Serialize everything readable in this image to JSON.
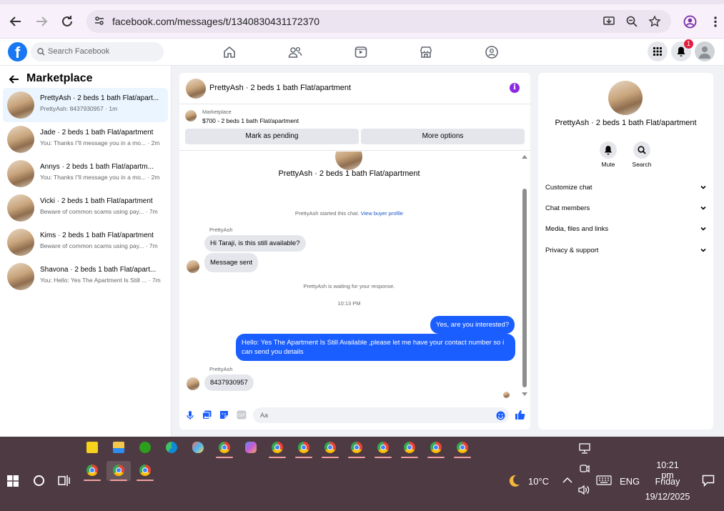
{
  "browser": {
    "url": "facebook.com/messages/t/1340830431172370"
  },
  "facebook": {
    "logo": "f",
    "search_placeholder": "Search Facebook",
    "notification_count": "1"
  },
  "left": {
    "title": "Marketplace",
    "conversations": [
      {
        "title": "PrettyAsh · 2 beds 1 bath Flat/apart...",
        "preview": "PrettyAsh: 8437930957 · 1m"
      },
      {
        "title": "Jade · 2 beds 1 bath Flat/apartment",
        "preview": "You: Thanks i\"ll message you in a mo... · 2m"
      },
      {
        "title": "Annys · 2 beds 1 bath Flat/apartm...",
        "preview": "You: Thanks i\"ll message you in a mo... · 2m"
      },
      {
        "title": "Vicki · 2 beds 1 bath Flat/apartment",
        "preview": "Beware of common scams using pay... · 7m"
      },
      {
        "title": "Kims · 2 beds 1 bath Flat/apartment",
        "preview": "Beware of common scams using pay... · 7m"
      },
      {
        "title": "Shavona · 2 beds 1 bath Flat/apart...",
        "preview": "You: Hello: Yes The Apartment Is Still ... · 7m"
      }
    ]
  },
  "chat": {
    "header_name": "PrettyAsh · 2 beds 1 bath Flat/apartment",
    "info_glyph": "i",
    "marketplace_label": "Marketplace",
    "listing": "$700 - 2 beds 1 bath Flat/apartment",
    "mark_pending": "Mark as pending",
    "more_options": "More options",
    "profile_name": "PrettyAsh · 2 beds 1 bath Flat/apartment",
    "started_text": "PrettyAsh started this chat.",
    "view_profile": "View buyer profile",
    "sender1": "PrettyAsh",
    "msg1": "Hi Taraji, is this still available?",
    "msg2": "Message sent",
    "waiting": "PrettyAsh is waiting for your response.",
    "time": "10:13 PM",
    "out1": "Yes, are you interested?",
    "out2": "Hello: Yes The Apartment Is Still Available ,please let me have your contact number so i can send you details",
    "sender2": "PrettyAsh",
    "msg3": "8437930957",
    "composer_placeholder": "Aa"
  },
  "right": {
    "name": "PrettyAsh · 2 beds 1 bath Flat/apartment",
    "mute": "Mute",
    "search": "Search",
    "sections": [
      "Customize chat",
      "Chat members",
      "Media, files and links",
      "Privacy & support"
    ]
  },
  "taskbar": {
    "temperature": "10°C",
    "language": "ENG",
    "time": "10:21 pm",
    "day": "Friday",
    "date": "19/12/2025"
  }
}
